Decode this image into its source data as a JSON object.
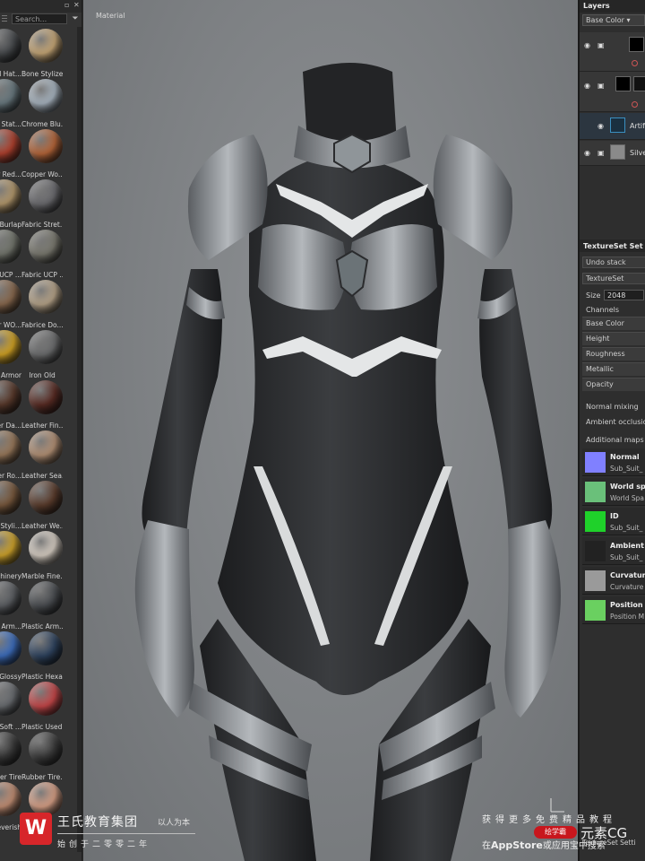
{
  "shelf": {
    "search_placeholder": "Search...",
    "pin_glyph": "▫",
    "close_glyph": "✕",
    "filter_glyph": "⏷",
    "materials": [
      {
        "name": "all Hat...",
        "col": "left",
        "color": "#4a4d50"
      },
      {
        "name": "Bone Stylized",
        "col": "right",
        "color": "#c9a978"
      },
      {
        "name": "e Stat...",
        "col": "left",
        "color": "#6a7a80"
      },
      {
        "name": "Chrome Blu...",
        "col": "right",
        "color": "#a9b6c2"
      },
      {
        "name": "r Red...",
        "col": "left",
        "color": "#b2422f"
      },
      {
        "name": "Copper Wo...",
        "col": "right",
        "color": "#b8673a"
      },
      {
        "name": "Burlap",
        "col": "left",
        "color": "#b59a6e"
      },
      {
        "name": "Fabric Stret...",
        "col": "right",
        "color": "#6c6c70"
      },
      {
        "name": "UCP ...",
        "col": "left",
        "color": "#74776e"
      },
      {
        "name": "Fabric UCP ...",
        "col": "right",
        "color": "#7b7a70"
      },
      {
        "name": "r WO...",
        "col": "left",
        "color": "#8a6a4f"
      },
      {
        "name": "Fabrice Do...",
        "col": "right",
        "color": "#b8a58a"
      },
      {
        "name": "Armor",
        "col": "left",
        "color": "#d3a425"
      },
      {
        "name": "Iron Old",
        "col": "right",
        "color": "#6d6e6f"
      },
      {
        "name": "er Da...",
        "col": "left",
        "color": "#5a3a2c"
      },
      {
        "name": "Leather Fin...",
        "col": "right",
        "color": "#5a2c24"
      },
      {
        "name": "er Ro...",
        "col": "left",
        "color": "#9a7a5c"
      },
      {
        "name": "Leather Sea...",
        "col": "right",
        "color": "#b59276"
      },
      {
        "name": "r Styli...",
        "col": "left",
        "color": "#7a5a3e"
      },
      {
        "name": "Leather We...",
        "col": "right",
        "color": "#5c3d2d"
      },
      {
        "name": "chinery",
        "col": "left",
        "color": "#d0a52c"
      },
      {
        "name": "Marble Fine...",
        "col": "right",
        "color": "#d8cfc4"
      },
      {
        "name": "Arm...",
        "col": "left",
        "color": "#5e6165"
      },
      {
        "name": "Plastic Arm...",
        "col": "right",
        "color": "#4b4e52"
      },
      {
        "name": "Glossy",
        "col": "left",
        "color": "#3e6fbf"
      },
      {
        "name": "Plastic Hexa...",
        "col": "right",
        "color": "#2f4460"
      },
      {
        "name": "Soft ...",
        "col": "left",
        "color": "#6b6e72"
      },
      {
        "name": "Plastic Used...",
        "col": "right",
        "color": "#c8484a"
      },
      {
        "name": "er Tire",
        "col": "left",
        "color": "#3c3c3c"
      },
      {
        "name": "Rubber Tire...",
        "col": "right",
        "color": "#3e3e3e"
      },
      {
        "name": "everish",
        "col": "left",
        "color": "#c49075"
      },
      {
        "name": "",
        "col": "right",
        "color": "#d9a187"
      }
    ]
  },
  "viewport": {
    "label": "Material"
  },
  "layers": {
    "title": "Layers",
    "channel": "Base Color ▾",
    "rows": [
      {
        "label": "",
        "eye": "◉",
        "icon": "▣"
      },
      {
        "label": "",
        "eye": "◉",
        "icon": "▣"
      },
      {
        "label": "Artifi",
        "eye": "◉",
        "icon": ""
      },
      {
        "label": "Silve",
        "eye": "◉",
        "icon": "▣"
      }
    ]
  },
  "textureset": {
    "title": "TextureSet Set",
    "undo": "Undo stack",
    "set": "TextureSet",
    "size_label": "Size",
    "size_value": "2048",
    "channels_label": "Channels",
    "channels": [
      "Base Color",
      "Height",
      "Roughness",
      "Metallic",
      "Opacity"
    ],
    "normal_mixing": "Normal mixing",
    "ambient_occlusion": "Ambient occlusio",
    "additional_maps": "Additional maps",
    "maps": [
      {
        "name": "Normal",
        "sub": "Sub_Suit_",
        "color": "#8080ff"
      },
      {
        "name": "World sp",
        "sub": "World Spa",
        "color": "#6ac07a"
      },
      {
        "name": "ID",
        "sub": "Sub_Suit_",
        "color": "#1fd12a"
      },
      {
        "name": "Ambient",
        "sub": "Sub_Suit_",
        "color": "#222222"
      },
      {
        "name": "Curvatur",
        "sub": "Curvature",
        "color": "#9a9a9a"
      },
      {
        "name": "Position",
        "sub": "Position M",
        "color": "#6ad060"
      }
    ]
  },
  "watermark": {
    "logo": "W",
    "title": "王氏教育集团",
    "slogan": "以人为本",
    "sub": "始创于二零零二年",
    "right_line1": "获得更多免费精品教程",
    "badge": "绘学霸",
    "brand": "元素CG",
    "right_line2_pre": "在",
    "right_line2_bold": "AppStore",
    "right_line2_post": "或应用宝中搜索",
    "tab": "TextureSet Setti"
  }
}
